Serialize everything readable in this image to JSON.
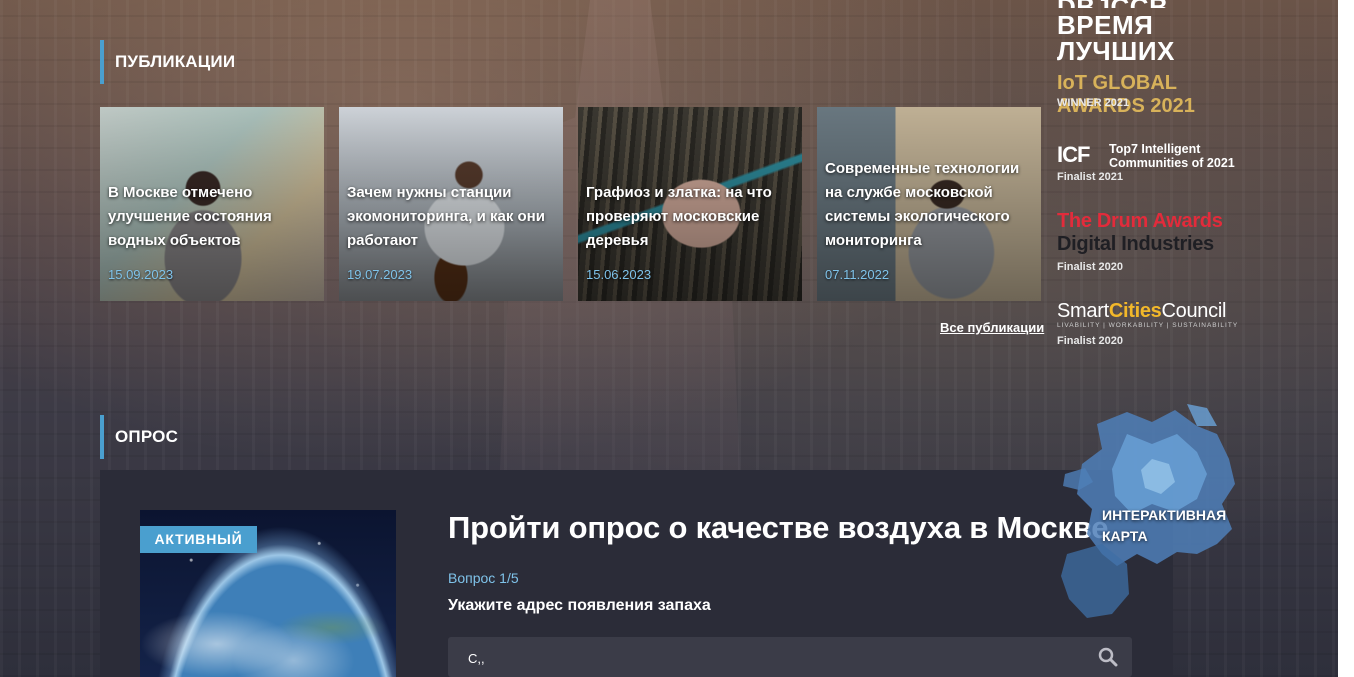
{
  "awards": {
    "top_title": "ВРЕМЯ ЛУЧШИХ",
    "top_cut_text": "DBJCCB",
    "iot_title": "IoT GLOBAL AWARDS 2021",
    "iot_sub": "WINNER 2021",
    "icf_logo": "ICF",
    "icf_title": "Top7 Intelligent Communities of 2021",
    "icf_sub": "Finalist 2021",
    "drum_line1": "The Drum Awards",
    "drum_line2": "Digital Industries",
    "drum_sub": "Finalist 2020",
    "smart_a": "Smart",
    "smart_b": "Cities",
    "smart_c": "Council",
    "smart_tagline": "LIVABILITY | WORKABILITY | SUSTAINABILITY",
    "smart_sub": "Finalist 2020"
  },
  "publications": {
    "section_title": "ПУБЛИКАЦИИ",
    "all_link": "Все публикации",
    "items": [
      {
        "title": "В Москве отмечено улучшение состояния водных объектов",
        "date": "15.09.2023"
      },
      {
        "title": "Зачем нужны станции экомониторинга, и как они работают",
        "date": "19.07.2023"
      },
      {
        "title": "Графиоз и златка: на что проверяют московские деревья",
        "date": "15.06.2023"
      },
      {
        "title": "Современные технологии на службе московской системы экологического мониторинга",
        "date": "07.11.2022"
      }
    ]
  },
  "survey": {
    "section_title": "ОПРОС",
    "badge": "АКТИВНЫЙ",
    "title": "Пройти опрос о качестве воздуха в Москве",
    "question_counter": "Вопрос 1/5",
    "prompt": "Укажите адрес появления запаха",
    "input_value": "С,,"
  },
  "map_widget": {
    "line1": "ИНТЕРАКТИВНАЯ",
    "line2": "КАРТА"
  },
  "colors": {
    "accent": "#4a9fcf",
    "date": "#7fc3ea",
    "panel": "#2b2c38",
    "gold": "#d8b25a",
    "drum_red": "#e22b3b",
    "smart_yellow": "#f2b82a"
  }
}
